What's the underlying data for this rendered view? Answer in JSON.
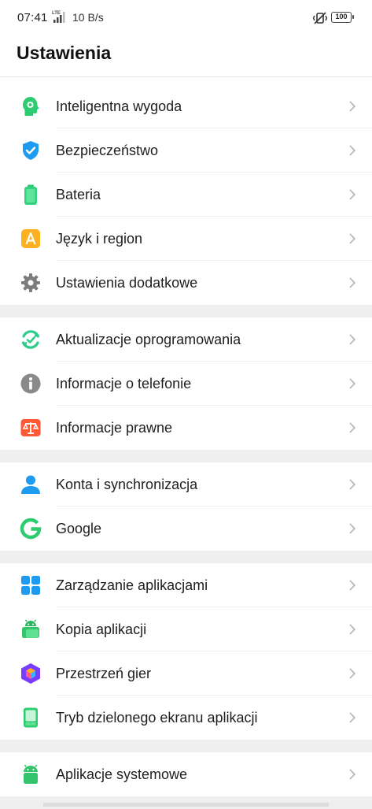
{
  "status_bar": {
    "time": "07:41",
    "network_speed": "10 B/s",
    "network_type": "LTE",
    "battery": "100",
    "icons": [
      "signal-icon",
      "vibrate-icon",
      "battery-icon"
    ]
  },
  "header": {
    "title": "Ustawienia"
  },
  "groups": [
    {
      "items": [
        {
          "label": "Inteligentna wygoda",
          "icon": "smart-assist-icon",
          "color": "#2ecc71"
        },
        {
          "label": "Bezpieczeństwo",
          "icon": "shield-check-icon",
          "color": "#1e9bf0"
        },
        {
          "label": "Bateria",
          "icon": "battery-icon",
          "color": "#35d07f"
        },
        {
          "label": "Język i region",
          "icon": "language-icon",
          "color": "#ffb020"
        },
        {
          "label": "Ustawienia dodatkowe",
          "icon": "gear-icon",
          "color": "#7d7d7d"
        }
      ]
    },
    {
      "items": [
        {
          "label": "Aktualizacje oprogramowania",
          "icon": "update-icon",
          "color": "#2ecc8a"
        },
        {
          "label": "Informacje o telefonie",
          "icon": "info-icon",
          "color": "#8a8a8a"
        },
        {
          "label": "Informacje prawne",
          "icon": "scales-icon",
          "color": "#ff5a36"
        }
      ]
    },
    {
      "items": [
        {
          "label": "Konta i synchronizacja",
          "icon": "person-icon",
          "color": "#1e9bf0"
        },
        {
          "label": "Google",
          "icon": "google-icon",
          "color": "#2ecc71"
        }
      ]
    },
    {
      "items": [
        {
          "label": "Zarządzanie aplikacjami",
          "icon": "apps-grid-icon",
          "color": "#1e9bf0"
        },
        {
          "label": "Kopia aplikacji",
          "icon": "android-clone-icon",
          "color": "#35c46b"
        },
        {
          "label": "Przestrzeń gier",
          "icon": "game-space-icon",
          "color": "#7a3cff"
        },
        {
          "label": "Tryb dzielonego ekranu aplikacji",
          "icon": "split-screen-icon",
          "color": "#2ecc71"
        }
      ]
    },
    {
      "items": [
        {
          "label": "Aplikacje systemowe",
          "icon": "android-icon",
          "color": "#35c46b"
        }
      ]
    }
  ]
}
